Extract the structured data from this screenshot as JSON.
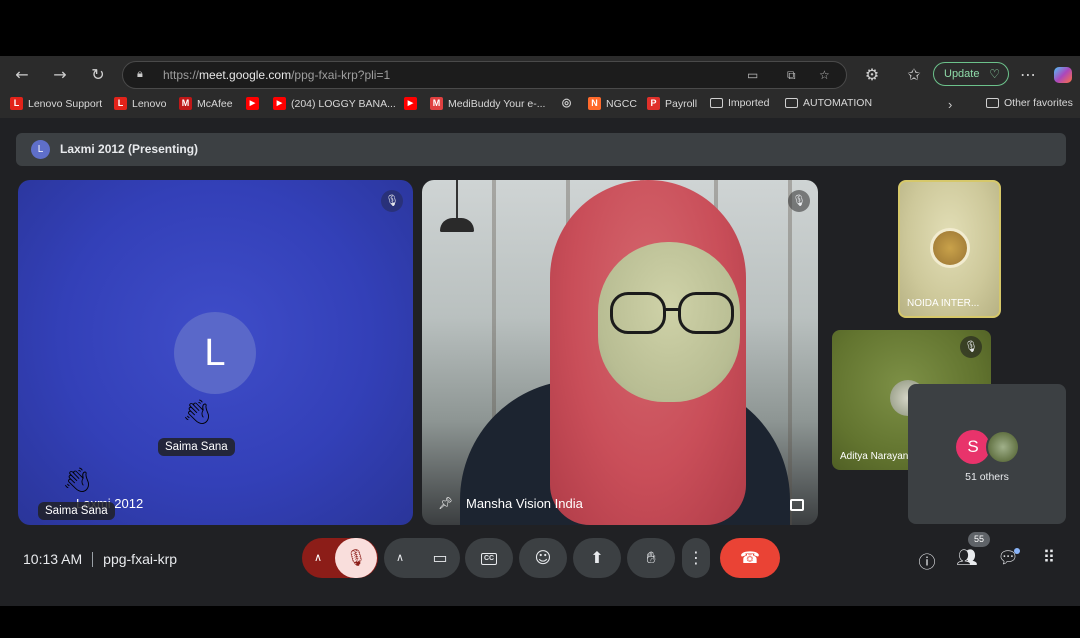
{
  "browser": {
    "url_prefix": "https://",
    "url_host": "meet.google.com",
    "url_path": "/ppg-fxai-krp?pli=1",
    "update_label": "Update",
    "bookmarks": [
      {
        "label": "Lenovo Support",
        "color": "#e2231a",
        "glyph": "L"
      },
      {
        "label": "Lenovo",
        "color": "#e2231a",
        "glyph": "L"
      },
      {
        "label": "McAfee",
        "color": "#c01818",
        "glyph": "M"
      },
      {
        "label": "",
        "color": "#ff0000",
        "glyph": "▶"
      },
      {
        "label": "(204) LOGGY BANA...",
        "color": "#ff0000",
        "glyph": "▶"
      },
      {
        "label": "",
        "color": "#ff0000",
        "glyph": "▶"
      },
      {
        "label": "MediBuddy Your e-...",
        "color": "#e04040",
        "glyph": "M"
      },
      {
        "label": "",
        "color": "#555555",
        "glyph": "◎"
      },
      {
        "label": "NGCC",
        "color": "#ff6a2c",
        "glyph": "N"
      },
      {
        "label": "Payroll",
        "color": "#e0302a",
        "glyph": "P"
      },
      {
        "label": "Imported",
        "folder": true
      },
      {
        "label": "AUTOMATION",
        "folder": true
      }
    ],
    "other_favorites": "Other favorites"
  },
  "meet": {
    "presenting_banner": "Laxmi 2012 (Presenting)",
    "presenter_initial": "L",
    "tiles": {
      "laxmi": {
        "initial": "L",
        "name": "Laxmi 2012",
        "reaction_name_1": "Saima Sana",
        "reaction_name_2": "Saima Sana"
      },
      "mansha": {
        "name": "Mansha Vision India"
      },
      "noida": {
        "name": "NOIDA INTER..."
      },
      "aditya": {
        "name": "Aditya Narayan"
      },
      "others": {
        "initial": "S",
        "label": "51 others"
      }
    },
    "bottom": {
      "time": "10:13 AM",
      "meeting_code": "ppg-fxai-krp",
      "people_count": "55"
    }
  },
  "colors": {
    "end_call": "#ea4335",
    "mic_off_bg": "#8c1d18",
    "accent_badge": "#8ab4f8"
  }
}
